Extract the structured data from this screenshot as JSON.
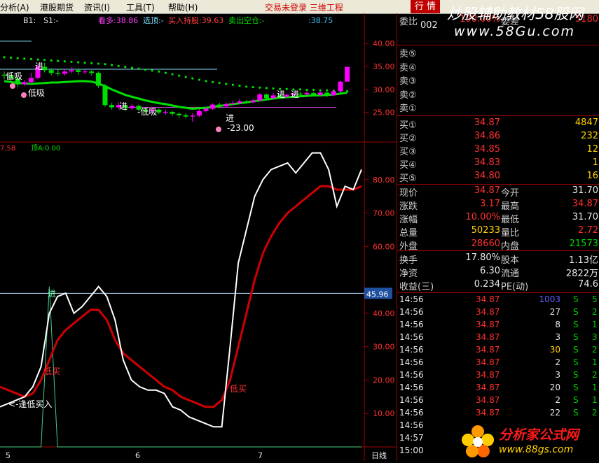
{
  "menu": {
    "items": [
      "分析(A)",
      "港股期货",
      "资讯(I)",
      "工具(T)",
      "帮助(H)"
    ],
    "status": "交易未登录  三维工程",
    "quote_button": "行 情"
  },
  "upper_panel": {
    "indicator_labels": [
      "B1:",
      "S1:-",
      "看多:38.86",
      "选顶:-",
      "买入持股:39.63",
      "卖出空仓:-",
      ":38.75"
    ],
    "y_ticks": [
      "40.00",
      "35.00",
      "30.00",
      "25.00"
    ],
    "annotations": [
      "进",
      "低吸",
      "进",
      "-低吸",
      "低吸",
      "进",
      "-23.00",
      "进",
      "进"
    ]
  },
  "lower_panel": {
    "header": "7.58",
    "indicator": "顶A:0.00",
    "y_ticks": [
      "80.00",
      "70.00",
      "60.00",
      "40.00",
      "30.00",
      "20.00",
      "10.00"
    ],
    "level_badge": "45.96",
    "annotations": [
      "进",
      "低买",
      "低买",
      "<-逢低买入"
    ],
    "x_labels": [
      "5",
      "6",
      "7"
    ],
    "period": "日线"
  },
  "quote": {
    "code": "002",
    "weibi_label": "委比",
    "weibi_value": "100.00%",
    "weicha_label": "委差",
    "weicha_value": "5180",
    "sells": [
      "卖⑤",
      "卖④",
      "卖③",
      "卖②",
      "卖①"
    ],
    "buys": [
      {
        "label": "买①",
        "price": "34.87",
        "vol": "4847"
      },
      {
        "label": "买②",
        "price": "34.86",
        "vol": "232"
      },
      {
        "label": "买③",
        "price": "34.85",
        "vol": "12"
      },
      {
        "label": "买④",
        "price": "34.83",
        "vol": "1"
      },
      {
        "label": "买⑤",
        "price": "34.80",
        "vol": "16"
      }
    ],
    "stats": [
      {
        "l1": "现价",
        "v1": "34.87",
        "c1": "red",
        "l2": "今开",
        "v2": "31.70",
        "c2": "white"
      },
      {
        "l1": "涨跌",
        "v1": "3.17",
        "c1": "red",
        "l2": "最高",
        "v2": "34.87",
        "c2": "red"
      },
      {
        "l1": "涨幅",
        "v1": "10.00%",
        "c1": "red",
        "l2": "最低",
        "v2": "31.70",
        "c2": "white"
      },
      {
        "l1": "总量",
        "v1": "50233",
        "c1": "yellow",
        "l2": "量比",
        "v2": "2.72",
        "c2": "red"
      },
      {
        "l1": "外盘",
        "v1": "28660",
        "c1": "red",
        "l2": "内盘",
        "v2": "21573",
        "c2": "green"
      }
    ],
    "fundamentals": [
      {
        "l1": "换手",
        "v1": "17.80%",
        "l2": "股本",
        "v2": "1.13亿"
      },
      {
        "l1": "净资",
        "v1": "6.30",
        "l2": "流通",
        "v2": "2822万"
      },
      {
        "l1": "收益(三)",
        "v1": "0.234",
        "l2": "PE(动)",
        "v2": "74.6"
      }
    ],
    "ticks": [
      {
        "t": "14:56",
        "p": "34.87",
        "v": "1003",
        "vc": "#6060ff",
        "s": "S",
        "n": "5"
      },
      {
        "t": "14:56",
        "p": "34.87",
        "v": "27",
        "vc": "#e8e8e8",
        "s": "S",
        "n": "2"
      },
      {
        "t": "14:56",
        "p": "34.87",
        "v": "8",
        "vc": "#e8e8e8",
        "s": "S",
        "n": "1"
      },
      {
        "t": "14:56",
        "p": "34.87",
        "v": "3",
        "vc": "#e8e8e8",
        "s": "S",
        "n": "3"
      },
      {
        "t": "14:56",
        "p": "34.87",
        "v": "30",
        "vc": "#ffd200",
        "s": "S",
        "n": "2"
      },
      {
        "t": "14:56",
        "p": "34.87",
        "v": "2",
        "vc": "#e8e8e8",
        "s": "S",
        "n": "1"
      },
      {
        "t": "14:56",
        "p": "34.87",
        "v": "3",
        "vc": "#e8e8e8",
        "s": "S",
        "n": "2"
      },
      {
        "t": "14:56",
        "p": "34.87",
        "v": "20",
        "vc": "#e8e8e8",
        "s": "S",
        "n": "1"
      },
      {
        "t": "14:56",
        "p": "34.87",
        "v": "2",
        "vc": "#e8e8e8",
        "s": "S",
        "n": "1"
      },
      {
        "t": "14:56",
        "p": "34.87",
        "v": "22",
        "vc": "#e8e8e8",
        "s": "S",
        "n": "2"
      },
      {
        "t": "14:56",
        "p": "",
        "v": "",
        "vc": "#e8e8e8",
        "s": "",
        "n": ""
      },
      {
        "t": "14:57",
        "p": "",
        "v": "",
        "vc": "#e8e8e8",
        "s": "",
        "n": ""
      },
      {
        "t": "15:00",
        "p": "",
        "v": "",
        "vc": "#e8e8e8",
        "s": "",
        "n": ""
      }
    ]
  },
  "watermarks": {
    "top_line1": "炒股辅助教材58股网",
    "top_line2": "www.58Gu.com",
    "bottom_line1": "分析家公式网",
    "bottom_line2": "www.88gs.com"
  },
  "colors": {
    "up": "#ff3030",
    "down": "#00d000",
    "kline_up_body": "#ff00ff",
    "ma_line": "#00e000",
    "dots": "#00e000",
    "white_line": "#ffffff",
    "red_line": "#d00000",
    "signal_line": "#44cc88",
    "grid": "#a00000"
  },
  "chart_data": [
    {
      "type": "candlestick",
      "y_ticks": [
        25,
        30,
        35,
        40
      ],
      "ylim": [
        21,
        42
      ],
      "candles": [
        {
          "o": 33.2,
          "c": 33.0,
          "h": 33.9,
          "l": 32.2
        },
        {
          "o": 33.0,
          "c": 32.4,
          "h": 33.4,
          "l": 31.8
        },
        {
          "o": 32.4,
          "c": 31.1,
          "h": 32.7,
          "l": 30.5
        },
        {
          "o": 31.1,
          "c": 31.6,
          "h": 32.1,
          "l": 30.8
        },
        {
          "o": 31.6,
          "c": 32.5,
          "h": 33.6,
          "l": 31.2
        },
        {
          "o": 32.5,
          "c": 34.9,
          "h": 35.4,
          "l": 32.2
        },
        {
          "o": 34.9,
          "c": 34.2,
          "h": 35.8,
          "l": 33.7
        },
        {
          "o": 34.2,
          "c": 33.6,
          "h": 34.6,
          "l": 33.1
        },
        {
          "o": 33.6,
          "c": 33.4,
          "h": 34.3,
          "l": 32.9
        },
        {
          "o": 33.4,
          "c": 33.9,
          "h": 34.5,
          "l": 33.0
        },
        {
          "o": 33.9,
          "c": 34.2,
          "h": 34.8,
          "l": 33.5
        },
        {
          "o": 34.2,
          "c": 33.8,
          "h": 34.6,
          "l": 33.2
        },
        {
          "o": 33.8,
          "c": 33.9,
          "h": 34.3,
          "l": 33.3
        },
        {
          "o": 33.9,
          "c": 33.6,
          "h": 34.2,
          "l": 33.0
        },
        {
          "o": 33.6,
          "c": 30.8,
          "h": 33.9,
          "l": 30.3
        },
        {
          "o": 30.8,
          "c": 26.6,
          "h": 31.2,
          "l": 26.2
        },
        {
          "o": 26.6,
          "c": 26.1,
          "h": 27.1,
          "l": 25.6
        },
        {
          "o": 26.1,
          "c": 26.6,
          "h": 27.2,
          "l": 25.7
        },
        {
          "o": 26.6,
          "c": 25.9,
          "h": 26.9,
          "l": 25.3
        },
        {
          "o": 25.9,
          "c": 26.4,
          "h": 26.9,
          "l": 25.5
        },
        {
          "o": 26.4,
          "c": 25.6,
          "h": 26.7,
          "l": 25.2
        },
        {
          "o": 25.6,
          "c": 25.3,
          "h": 26.0,
          "l": 24.9
        },
        {
          "o": 25.3,
          "c": 25.6,
          "h": 26.0,
          "l": 24.9
        },
        {
          "o": 25.6,
          "c": 25.0,
          "h": 25.9,
          "l": 24.6
        },
        {
          "o": 25.0,
          "c": 25.1,
          "h": 25.6,
          "l": 24.5
        },
        {
          "o": 25.1,
          "c": 24.7,
          "h": 25.4,
          "l": 24.2
        },
        {
          "o": 24.7,
          "c": 24.4,
          "h": 25.0,
          "l": 23.9
        },
        {
          "o": 24.4,
          "c": 24.1,
          "h": 24.8,
          "l": 23.7
        },
        {
          "o": 24.1,
          "c": 24.3,
          "h": 24.8,
          "l": 23.0
        },
        {
          "o": 24.3,
          "c": 25.3,
          "h": 25.7,
          "l": 24.0
        },
        {
          "o": 25.3,
          "c": 25.8,
          "h": 26.2,
          "l": 25.0
        },
        {
          "o": 25.8,
          "c": 26.7,
          "h": 27.0,
          "l": 25.5
        },
        {
          "o": 26.7,
          "c": 26.3,
          "h": 27.1,
          "l": 25.9
        },
        {
          "o": 26.3,
          "c": 26.8,
          "h": 27.2,
          "l": 26.0
        },
        {
          "o": 26.8,
          "c": 27.0,
          "h": 27.5,
          "l": 26.5
        },
        {
          "o": 27.0,
          "c": 27.4,
          "h": 27.9,
          "l": 26.8
        },
        {
          "o": 27.4,
          "c": 27.2,
          "h": 27.7,
          "l": 26.9
        },
        {
          "o": 27.2,
          "c": 27.6,
          "h": 28.0,
          "l": 27.0
        },
        {
          "o": 27.6,
          "c": 28.9,
          "h": 29.2,
          "l": 27.4
        },
        {
          "o": 28.9,
          "c": 28.1,
          "h": 29.1,
          "l": 27.8
        },
        {
          "o": 28.1,
          "c": 28.7,
          "h": 29.3,
          "l": 27.9
        },
        {
          "o": 28.7,
          "c": 28.4,
          "h": 29.0,
          "l": 28.1
        },
        {
          "o": 28.4,
          "c": 28.8,
          "h": 29.2,
          "l": 28.2
        },
        {
          "o": 28.8,
          "c": 29.1,
          "h": 29.5,
          "l": 28.5
        },
        {
          "o": 29.1,
          "c": 28.9,
          "h": 29.5,
          "l": 28.6
        },
        {
          "o": 28.9,
          "c": 29.2,
          "h": 29.6,
          "l": 28.7
        },
        {
          "o": 29.2,
          "c": 28.8,
          "h": 29.4,
          "l": 28.5
        },
        {
          "o": 28.8,
          "c": 29.3,
          "h": 29.7,
          "l": 28.6
        },
        {
          "o": 29.3,
          "c": 28.7,
          "h": 29.5,
          "l": 28.3
        },
        {
          "o": 28.7,
          "c": 29.6,
          "h": 30.0,
          "l": 28.5
        },
        {
          "o": 29.6,
          "c": 31.7,
          "h": 31.9,
          "l": 29.4
        },
        {
          "o": 31.7,
          "c": 34.9,
          "h": 34.9,
          "l": 31.7
        }
      ],
      "ma": [
        31.8,
        31.6,
        31.4,
        31.3,
        31.2,
        31.3,
        31.4,
        31.5,
        31.5,
        31.6,
        31.7,
        31.8,
        31.8,
        31.7,
        31.3,
        30.7,
        30.0,
        29.4,
        28.8,
        28.4,
        28.0,
        27.6,
        27.3,
        27.0,
        26.8,
        26.5,
        26.2,
        26.0,
        25.8,
        25.9,
        26.0,
        26.2,
        26.4,
        26.6,
        26.8,
        27.0,
        27.2,
        27.4,
        27.6,
        27.8,
        28.0,
        28.2,
        28.3,
        28.4,
        28.5,
        28.6,
        28.7,
        28.7,
        28.8,
        28.9,
        29.1,
        29.3
      ],
      "dots": [
        37.0,
        36.9,
        36.8,
        36.7,
        36.6,
        36.5,
        36.4,
        36.3,
        36.2,
        36.1,
        36.0,
        35.9,
        35.8,
        35.7,
        35.6,
        35.5,
        35.3,
        35.1,
        34.9,
        34.7,
        34.5,
        34.3,
        34.1,
        33.9,
        33.6,
        33.3,
        33.0,
        32.7,
        32.4,
        32.1,
        31.8,
        31.6,
        31.4,
        31.2,
        31.0,
        30.8,
        30.6,
        30.5,
        30.4,
        30.3,
        30.2,
        30.1,
        30.1,
        30.0,
        30.0,
        29.9,
        29.9,
        29.8,
        29.8,
        29.7,
        29.7,
        29.6
      ],
      "ref_lines": [
        34.4,
        26.1
      ]
    },
    {
      "type": "line",
      "ylim": [
        0,
        90
      ],
      "y_ticks": [
        10,
        20,
        30,
        40,
        60,
        70,
        80
      ],
      "level": 45.96,
      "series": [
        {
          "values": [
            12,
            13,
            14,
            15,
            18,
            24,
            40,
            45,
            46,
            40,
            42,
            45,
            48,
            45,
            38,
            26,
            20,
            18,
            17,
            17,
            16,
            12,
            11,
            9,
            8,
            7,
            6,
            6,
            30,
            55,
            65,
            75,
            80,
            83,
            84,
            85,
            82,
            85,
            88,
            88,
            83,
            72,
            78,
            77,
            83
          ]
        },
        {
          "values": [
            18,
            17,
            16,
            15,
            16,
            20,
            26,
            32,
            35,
            37,
            39,
            41,
            41,
            38,
            32,
            28,
            26,
            24,
            22,
            20,
            18,
            17,
            15,
            14,
            13,
            12,
            12,
            14,
            20,
            30,
            40,
            50,
            58,
            63,
            67,
            70,
            72,
            74,
            76,
            78,
            78,
            77,
            77,
            77,
            78
          ]
        },
        {
          "values": [
            0,
            0,
            0,
            0,
            0,
            0,
            48,
            0,
            0,
            0,
            0,
            0,
            0,
            0,
            0,
            0,
            0,
            0,
            0,
            0,
            0,
            0,
            0,
            0,
            0,
            0,
            0,
            0,
            0,
            0,
            0,
            0,
            0,
            0,
            0,
            0,
            0,
            0,
            0,
            0,
            0,
            0,
            0,
            0,
            0
          ]
        }
      ]
    }
  ]
}
